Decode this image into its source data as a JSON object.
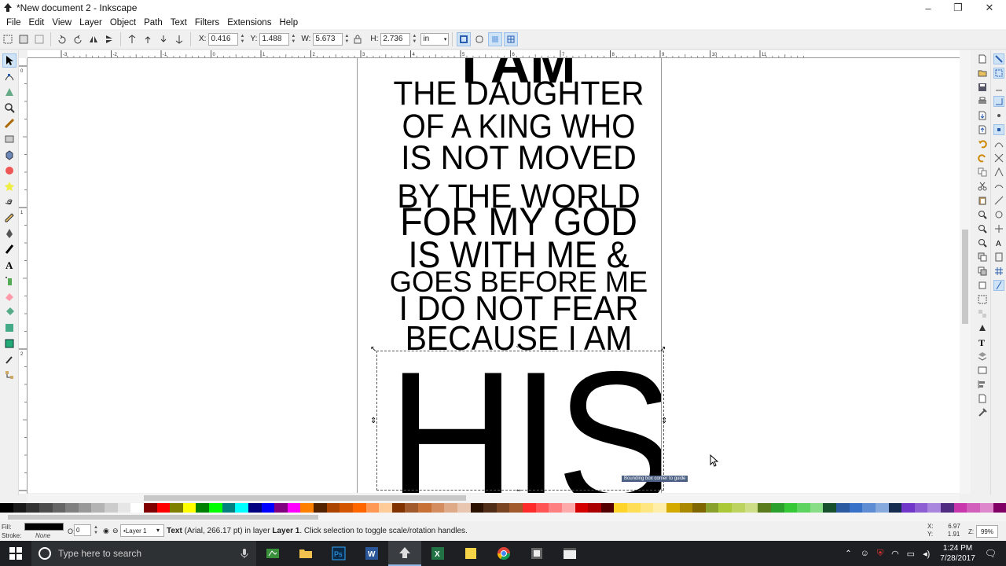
{
  "window": {
    "title": "*New document 2 - Inkscape",
    "controls": [
      "–",
      "❐",
      "✕"
    ]
  },
  "menu": [
    "File",
    "Edit",
    "View",
    "Layer",
    "Object",
    "Path",
    "Text",
    "Filters",
    "Extensions",
    "Help"
  ],
  "controls": {
    "x_label": "X:",
    "x_value": "0.416",
    "y_label": "Y:",
    "y_value": "1.488",
    "w_label": "W:",
    "w_value": "5.673",
    "h_label": "H:",
    "h_value": "2.736",
    "unit": "in"
  },
  "ruler_h_labels": [
    "-3",
    "-2",
    "-1",
    "0",
    "1",
    "2",
    "3",
    "4",
    "5",
    "6",
    "7",
    "8",
    "9",
    "10",
    "11"
  ],
  "ruler_v_labels": [
    "0",
    "1",
    "2",
    "3"
  ],
  "poster": {
    "lines": [
      "I AM",
      "THE DAUGHTER",
      "OF A KING WHO",
      "IS NOT MOVED",
      "BY THE WORLD",
      "FOR MY GOD",
      "IS WITH ME &",
      "GOES BEFORE ME",
      "I DO NOT FEAR",
      "BECAUSE I AM",
      "HIS"
    ]
  },
  "snap_tooltip": "Bounding box corner to guide",
  "status": {
    "fill_label": "Fill:",
    "stroke_label": "Stroke:",
    "stroke_value": "None",
    "opacity_label": "O:",
    "opacity_value": "0",
    "layer": "•Layer 1",
    "message_bold": "Text",
    "message": "(Arial, 266.17 pt) in layer",
    "message_layer": "Layer 1",
    "message_tail": ". Click selection to toggle scale/rotation handles.",
    "x_label": "X:",
    "x_value": "6.97",
    "y_label": "Y:",
    "y_value": "1.91",
    "zoom_label": "Z:",
    "zoom_value": "99%"
  },
  "taskbar": {
    "search_placeholder": "Type here to search",
    "time": "1:24 PM",
    "date": "7/28/2017"
  },
  "palette_colors": [
    "#000000",
    "#1a1a1a",
    "#333333",
    "#4d4d4d",
    "#666666",
    "#808080",
    "#999999",
    "#b3b3b3",
    "#cccccc",
    "#e6e6e6",
    "#ffffff",
    "#800000",
    "#ff0000",
    "#808000",
    "#ffff00",
    "#008000",
    "#00ff00",
    "#008080",
    "#00ffff",
    "#000080",
    "#0000ff",
    "#800080",
    "#ff00ff",
    "#ff8000",
    "#552200",
    "#aa4400",
    "#d45500",
    "#ff6600",
    "#ff9955",
    "#ffcc99",
    "#803300",
    "#a05a2c",
    "#c87137",
    "#d38d5f",
    "#deaa87",
    "#e9c6af",
    "#2b1100",
    "#502d16",
    "#784421",
    "#a05a2c",
    "#ff2a2a",
    "#ff5555",
    "#ff8080",
    "#ffaaaa",
    "#d40000",
    "#aa0000",
    "#550000",
    "#ffd42a",
    "#ffdd55",
    "#ffe680",
    "#ffeeaa",
    "#d4aa00",
    "#aa8800",
    "#806600",
    "#89a02c",
    "#abc837",
    "#bcd35f",
    "#cdde87",
    "#5a7c1c",
    "#2ca02c",
    "#37c837",
    "#5fd35f",
    "#87de87",
    "#16502d",
    "#2c5aa0",
    "#3771c8",
    "#5f8dd3",
    "#87aade",
    "#162d50",
    "#7137c8",
    "#8d5fd3",
    "#aa87de",
    "#502d80",
    "#c837ab",
    "#d35fbc",
    "#de87cd",
    "#800066"
  ]
}
